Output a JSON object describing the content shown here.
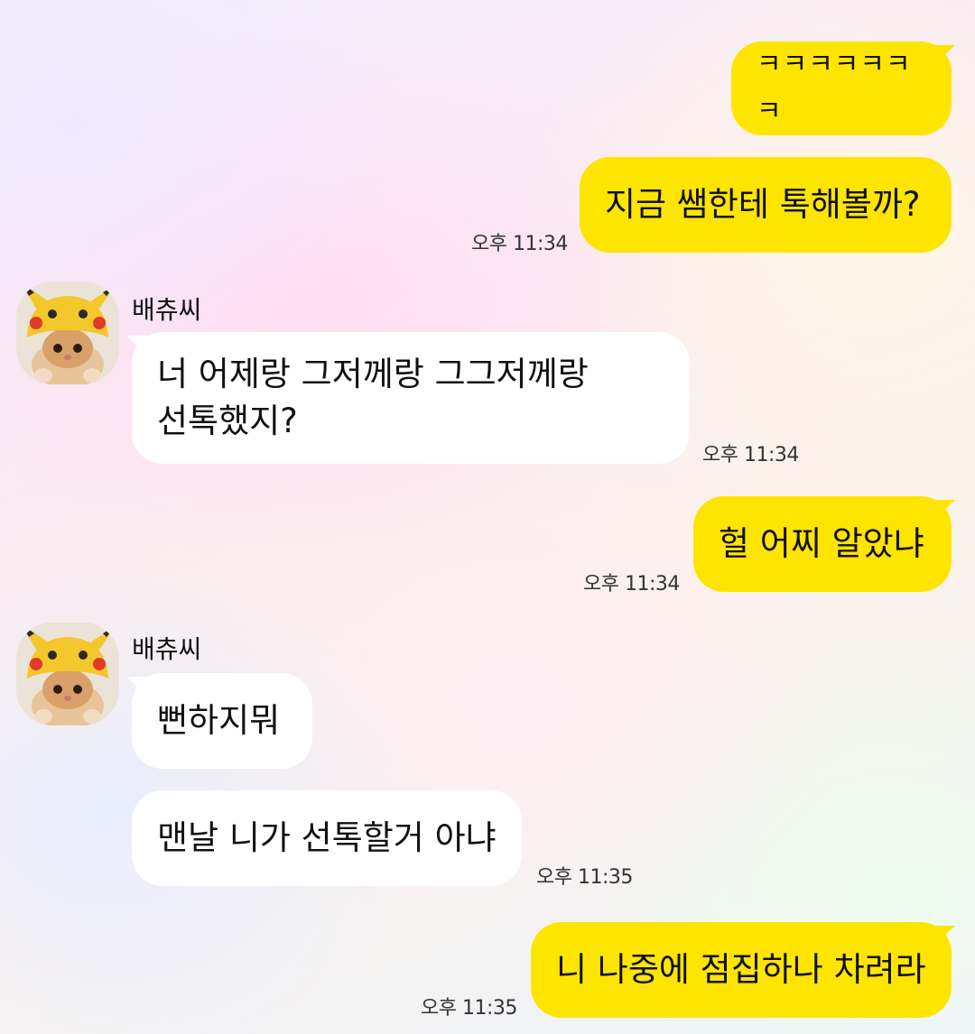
{
  "chat": {
    "messages": [
      {
        "from": "me",
        "text": "ㅋㅋㅋㅋㅋㅋㅋ"
      },
      {
        "from": "me",
        "text": "지금 쌤한테 톡해볼까?",
        "time": "오후 11:34"
      },
      {
        "from": "them",
        "sender": "배츄씨",
        "text": "너 어제랑 그저께랑 그그저께랑\n선톡했지?",
        "time": "오후 11:34"
      },
      {
        "from": "me",
        "text": "헐 어찌 알았냐",
        "time": "오후 11:34"
      },
      {
        "from": "them",
        "sender": "배츄씨",
        "text": "뻔하지뭐"
      },
      {
        "from": "them",
        "text": "맨날 니가 선톡할거 아냐",
        "time": "오후 11:35"
      },
      {
        "from": "me",
        "text": "니 나중에 점집하나 차려라",
        "time": "오후 11:35"
      }
    ]
  },
  "icons": {
    "avatar": "pikachu-hat-cat-avatar"
  },
  "colors": {
    "my_bubble": "#fee500",
    "their_bubble": "#ffffff",
    "text": "#111111"
  }
}
